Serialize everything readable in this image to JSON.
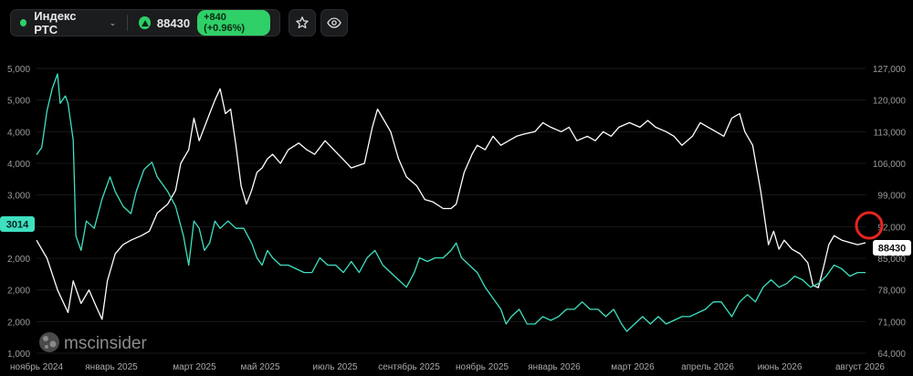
{
  "header": {
    "ticker_name": "Индекс РТС",
    "price": "88430",
    "change": "+840 (+0.96%)",
    "icons": [
      "status-dot",
      "chevron-down-icon",
      "arrow-up-icon",
      "star-icon",
      "eye-icon"
    ]
  },
  "watermark": "mscinsider",
  "colors": {
    "price_line": "#ffffff",
    "secondary_line": "#3ee0c0",
    "up": "#2fd067",
    "marker": "#e52520",
    "background": "#000000"
  },
  "chart_data": {
    "type": "line",
    "x_labels": [
      "ноябрь 2024",
      "январь 2025",
      "март 2025",
      "май 2025",
      "июль 2025",
      "сентябрь 2025",
      "ноябрь 2025",
      "январь 2026",
      "март 2026",
      "апрель 2026",
      "июнь 2026",
      "август 2026"
    ],
    "left_axis": {
      "ticks": [
        "5,000",
        "5,000",
        "4,000",
        "4,000",
        "3,000",
        "3,000",
        "2,000",
        "2,000",
        "2,000",
        "1,000"
      ]
    },
    "right_axis": {
      "ticks": [
        "127,000",
        "120,000",
        "113,000",
        "106,000",
        "99,000",
        "92,000",
        "85,000",
        "78,000",
        "71,000",
        "64,000"
      ],
      "ylim": [
        64000,
        127000
      ]
    },
    "current_labels": {
      "left": "3014",
      "right": "88430"
    },
    "series": [
      {
        "color": "#ffffff",
        "axis": "right",
        "points": [
          [
            0,
            89000
          ],
          [
            4,
            85000
          ],
          [
            8,
            78000
          ],
          [
            12,
            73000
          ],
          [
            14,
            80000
          ],
          [
            17,
            75000
          ],
          [
            20,
            78000
          ],
          [
            23,
            74000
          ],
          [
            25,
            71500
          ],
          [
            27,
            80000
          ],
          [
            30,
            86000
          ],
          [
            33,
            88000
          ],
          [
            36,
            89000
          ],
          [
            40,
            90000
          ],
          [
            43,
            91000
          ],
          [
            46,
            95000
          ],
          [
            50,
            97000
          ],
          [
            53,
            100000
          ],
          [
            55,
            106000
          ],
          [
            58,
            109000
          ],
          [
            60,
            116000
          ],
          [
            62,
            111000
          ],
          [
            64,
            114000
          ],
          [
            66,
            117000
          ],
          [
            68,
            120000
          ],
          [
            70,
            122500
          ],
          [
            72,
            117000
          ],
          [
            74,
            118000
          ],
          [
            76,
            110000
          ],
          [
            78,
            101000
          ],
          [
            80,
            97000
          ],
          [
            82,
            100000
          ],
          [
            84,
            104000
          ],
          [
            86,
            105000
          ],
          [
            88,
            107000
          ],
          [
            90,
            108000
          ],
          [
            93,
            106000
          ],
          [
            96,
            109000
          ],
          [
            100,
            110500
          ],
          [
            103,
            109000
          ],
          [
            106,
            108000
          ],
          [
            110,
            111000
          ],
          [
            115,
            108000
          ],
          [
            120,
            105000
          ],
          [
            125,
            106000
          ],
          [
            128,
            114000
          ],
          [
            130,
            118000
          ],
          [
            132,
            116000
          ],
          [
            135,
            113000
          ],
          [
            138,
            107000
          ],
          [
            141,
            103000
          ],
          [
            145,
            101000
          ],
          [
            148,
            98000
          ],
          [
            151,
            97500
          ],
          [
            155,
            96000
          ],
          [
            158,
            96000
          ],
          [
            160,
            97000
          ],
          [
            163,
            104000
          ],
          [
            166,
            108000
          ],
          [
            168,
            110000
          ],
          [
            171,
            109000
          ],
          [
            174,
            112000
          ],
          [
            177,
            110000
          ],
          [
            180,
            111000
          ],
          [
            183,
            112000
          ],
          [
            186,
            112500
          ],
          [
            190,
            113000
          ],
          [
            193,
            115000
          ],
          [
            196,
            114000
          ],
          [
            200,
            113000
          ],
          [
            203,
            114000
          ],
          [
            206,
            111000
          ],
          [
            210,
            112000
          ],
          [
            213,
            111000
          ],
          [
            216,
            113000
          ],
          [
            219,
            112000
          ],
          [
            222,
            114000
          ],
          [
            226,
            115000
          ],
          [
            230,
            114000
          ],
          [
            233,
            115500
          ],
          [
            236,
            114000
          ],
          [
            240,
            113000
          ],
          [
            243,
            112000
          ],
          [
            246,
            110000
          ],
          [
            250,
            112000
          ],
          [
            253,
            115000
          ],
          [
            256,
            114000
          ],
          [
            259,
            113000
          ],
          [
            262,
            112000
          ],
          [
            265,
            116000
          ],
          [
            268,
            117000
          ],
          [
            270,
            113000
          ],
          [
            273,
            110000
          ],
          [
            276,
            100000
          ],
          [
            279,
            88000
          ],
          [
            281,
            91000
          ],
          [
            283,
            87000
          ],
          [
            285,
            89000
          ],
          [
            288,
            87000
          ],
          [
            291,
            86000
          ],
          [
            294,
            84000
          ],
          [
            296,
            79000
          ],
          [
            298,
            78500
          ],
          [
            300,
            83000
          ],
          [
            302,
            88000
          ],
          [
            304,
            90000
          ],
          [
            307,
            89000
          ],
          [
            310,
            88500
          ],
          [
            313,
            88000
          ],
          [
            316,
            88430
          ]
        ]
      },
      {
        "color": "#3ee0c0",
        "axis": "left",
        "points": [
          [
            0,
            4300
          ],
          [
            2,
            4400
          ],
          [
            4,
            4900
          ],
          [
            6,
            5200
          ],
          [
            8,
            5400
          ],
          [
            9,
            5000
          ],
          [
            11,
            5100
          ],
          [
            12,
            5000
          ],
          [
            14,
            4500
          ],
          [
            15,
            3200
          ],
          [
            17,
            3000
          ],
          [
            19,
            3400
          ],
          [
            22,
            3300
          ],
          [
            25,
            3700
          ],
          [
            28,
            4000
          ],
          [
            30,
            3800
          ],
          [
            33,
            3600
          ],
          [
            36,
            3500
          ],
          [
            38,
            3800
          ],
          [
            41,
            4100
          ],
          [
            44,
            4200
          ],
          [
            46,
            4000
          ],
          [
            50,
            3800
          ],
          [
            53,
            3600
          ],
          [
            56,
            3200
          ],
          [
            58,
            2800
          ],
          [
            60,
            3400
          ],
          [
            62,
            3300
          ],
          [
            64,
            3000
          ],
          [
            66,
            3100
          ],
          [
            68,
            3400
          ],
          [
            70,
            3300
          ],
          [
            73,
            3400
          ],
          [
            76,
            3300
          ],
          [
            79,
            3300
          ],
          [
            82,
            3100
          ],
          [
            84,
            2900
          ],
          [
            86,
            2800
          ],
          [
            88,
            3000
          ],
          [
            90,
            2900
          ],
          [
            93,
            2800
          ],
          [
            96,
            2800
          ],
          [
            99,
            2750
          ],
          [
            102,
            2700
          ],
          [
            105,
            2700
          ],
          [
            108,
            2900
          ],
          [
            111,
            2800
          ],
          [
            114,
            2800
          ],
          [
            117,
            2700
          ],
          [
            120,
            2850
          ],
          [
            123,
            2700
          ],
          [
            126,
            2900
          ],
          [
            129,
            3000
          ],
          [
            132,
            2800
          ],
          [
            135,
            2700
          ],
          [
            138,
            2600
          ],
          [
            141,
            2500
          ],
          [
            144,
            2700
          ],
          [
            146,
            2900
          ],
          [
            149,
            2850
          ],
          [
            152,
            2900
          ],
          [
            155,
            2900
          ],
          [
            158,
            3000
          ],
          [
            160,
            3100
          ],
          [
            162,
            2900
          ],
          [
            165,
            2800
          ],
          [
            168,
            2700
          ],
          [
            171,
            2500
          ],
          [
            174,
            2350
          ],
          [
            177,
            2200
          ],
          [
            179,
            2000
          ],
          [
            181,
            2100
          ],
          [
            184,
            2200
          ],
          [
            187,
            2000
          ],
          [
            190,
            2000
          ],
          [
            193,
            2100
          ],
          [
            196,
            2050
          ],
          [
            199,
            2100
          ],
          [
            202,
            2200
          ],
          [
            205,
            2200
          ],
          [
            208,
            2300
          ],
          [
            211,
            2200
          ],
          [
            214,
            2200
          ],
          [
            217,
            2100
          ],
          [
            220,
            2200
          ],
          [
            223,
            2000
          ],
          [
            225,
            1900
          ],
          [
            228,
            2000
          ],
          [
            231,
            2100
          ],
          [
            234,
            2000
          ],
          [
            237,
            2100
          ],
          [
            240,
            2000
          ],
          [
            243,
            2050
          ],
          [
            246,
            2100
          ],
          [
            249,
            2100
          ],
          [
            252,
            2150
          ],
          [
            255,
            2200
          ],
          [
            258,
            2300
          ],
          [
            261,
            2300
          ],
          [
            263,
            2200
          ],
          [
            265,
            2100
          ],
          [
            268,
            2300
          ],
          [
            271,
            2400
          ],
          [
            274,
            2300
          ],
          [
            277,
            2500
          ],
          [
            280,
            2600
          ],
          [
            283,
            2500
          ],
          [
            286,
            2550
          ],
          [
            289,
            2650
          ],
          [
            292,
            2600
          ],
          [
            295,
            2500
          ],
          [
            298,
            2550
          ],
          [
            301,
            2650
          ],
          [
            304,
            2800
          ],
          [
            307,
            2750
          ],
          [
            310,
            2650
          ],
          [
            313,
            2700
          ],
          [
            316,
            2700
          ]
        ]
      }
    ]
  }
}
